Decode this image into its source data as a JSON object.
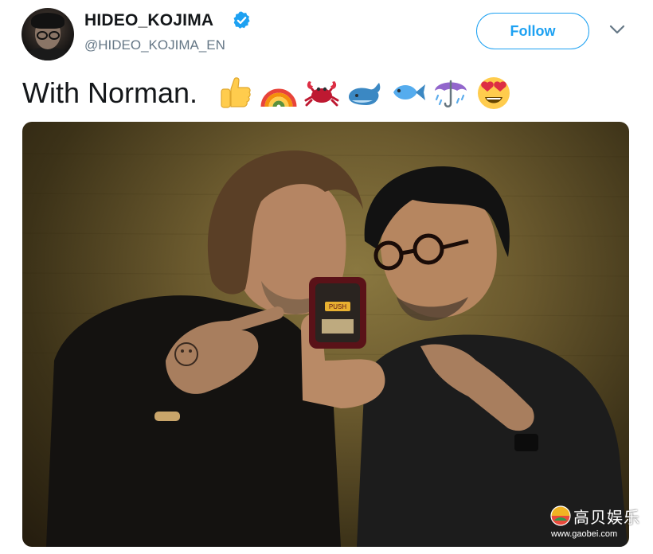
{
  "tweet": {
    "display_name": "HIDEO_KOJIMA",
    "handle": "@HIDEO_KOJIMA_EN",
    "text": "With Norman.",
    "emojis": [
      "thumbs-up",
      "rainbow",
      "crab",
      "whale",
      "fish",
      "umbrella-with-rain",
      "heart-eyes-face"
    ]
  },
  "actions": {
    "follow_label": "Follow"
  },
  "photo": {
    "device_label": "PUSH"
  },
  "watermark": {
    "text": "高贝娱乐",
    "url": "www.gaobei.com"
  },
  "colors": {
    "accent": "#1da1f2",
    "text": "#14171a",
    "secondary": "#657786"
  }
}
